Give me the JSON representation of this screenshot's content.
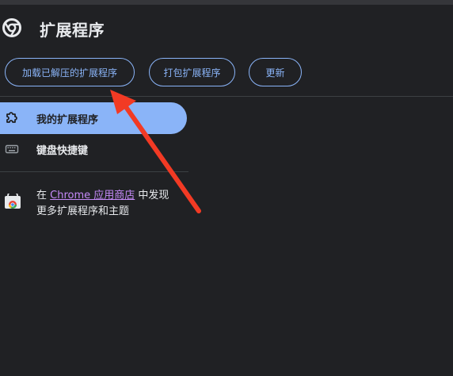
{
  "header": {
    "title": "扩展程序",
    "logo_icon": "chrome-logo-icon"
  },
  "toolbar": {
    "load_unpacked_label": "加载已解压的扩展程序",
    "pack_label": "打包扩展程序",
    "update_label": "更新"
  },
  "sidebar": {
    "items": [
      {
        "label": "我的扩展程序",
        "icon": "puzzle-piece-icon",
        "selected": true
      },
      {
        "label": "键盘快捷键",
        "icon": "keyboard-icon",
        "selected": false
      }
    ],
    "store_promo": {
      "prefix": "在 ",
      "link_text": "Chrome 应用商店",
      "suffix": " 中发现",
      "line2": "更多扩展程序和主题",
      "icon": "web-store-icon"
    }
  },
  "colors": {
    "background": "#202124",
    "accent": "#8ab4f8",
    "link": "#c58af9",
    "annotation_arrow": "#f23a24"
  }
}
